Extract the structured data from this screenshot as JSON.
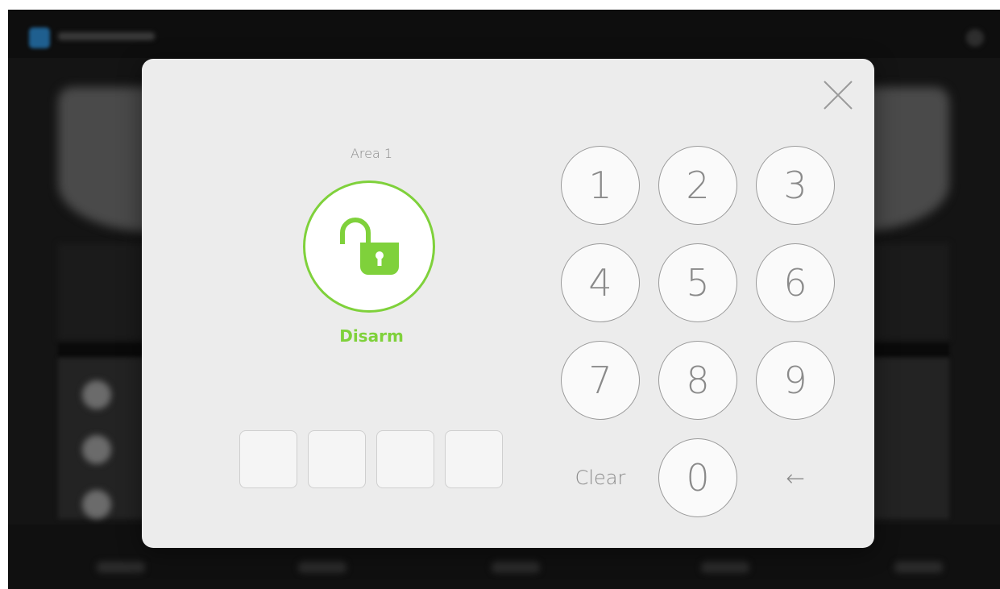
{
  "modal": {
    "close_icon": "close-icon",
    "area_label": "Area 1",
    "lock_icon": "unlocked-padlock-icon",
    "action_label": "Disarm",
    "accent_color": "#7fd13b",
    "code_slots": 4,
    "keypad": {
      "keys": [
        "1",
        "2",
        "3",
        "4",
        "5",
        "6",
        "7",
        "8",
        "9"
      ],
      "clear_label": "Clear",
      "zero_label": "0",
      "backspace_label": "←"
    }
  }
}
